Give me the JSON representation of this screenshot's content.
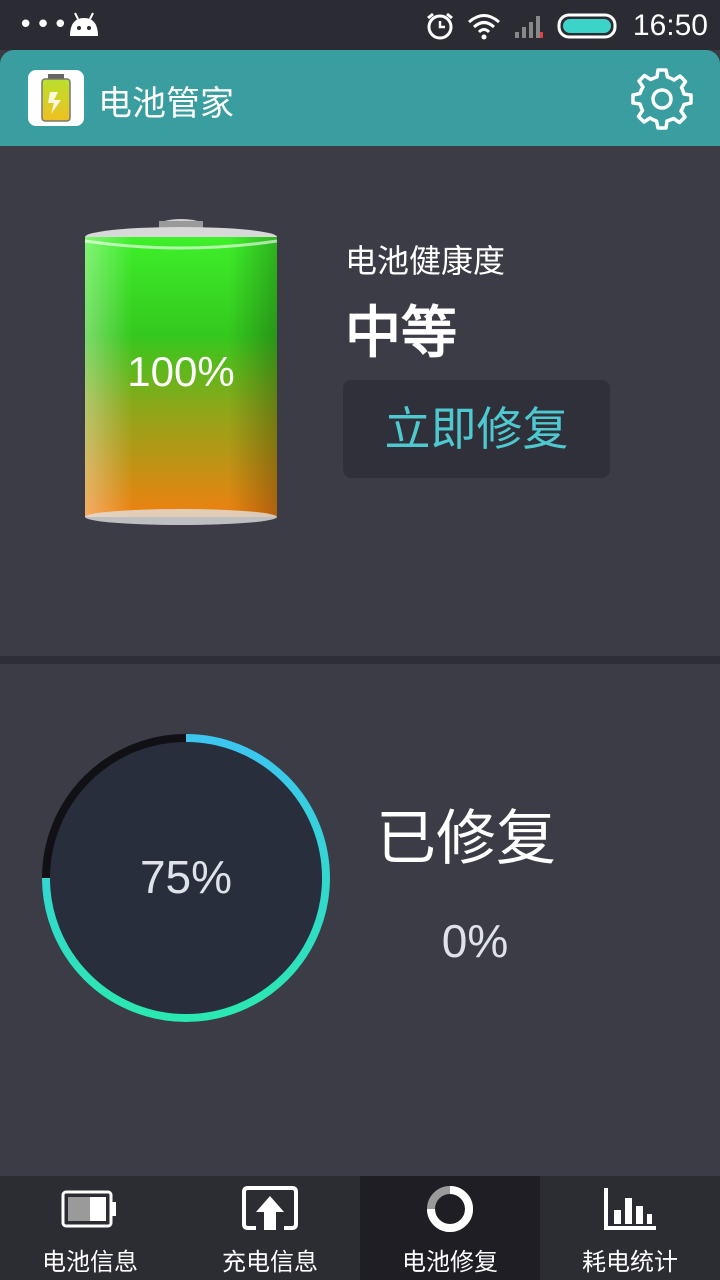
{
  "status_bar": {
    "time": "16:50",
    "icons": [
      "more-dots-icon",
      "android-icon",
      "alarm-icon",
      "wifi-icon",
      "signal-icon",
      "battery-icon"
    ]
  },
  "app_bar": {
    "title": "电池管家",
    "icons": [
      "app-battery-icon",
      "settings-gear-icon"
    ]
  },
  "battery_health": {
    "battery_level": "100%",
    "label": "电池健康度",
    "value": "中等",
    "repair_button": "立即修复"
  },
  "repair_progress": {
    "ring_percent": "75%",
    "ring_fraction": 0.75,
    "repaired_label": "已修复",
    "repaired_percent": "0%"
  },
  "bottom_nav": {
    "items": [
      {
        "label": "电池信息",
        "icon": "battery-info-icon"
      },
      {
        "label": "充电信息",
        "icon": "charge-upload-icon"
      },
      {
        "label": "电池修复",
        "icon": "repair-ring-icon",
        "active": true
      },
      {
        "label": "耗电统计",
        "icon": "bar-chart-icon"
      }
    ]
  },
  "colors": {
    "app_bar": "#3a9ea0",
    "background": "#3c3c46",
    "accent_text": "#4fc9d0",
    "ring_start": "#2be8b0",
    "ring_end": "#3cc6f0"
  }
}
